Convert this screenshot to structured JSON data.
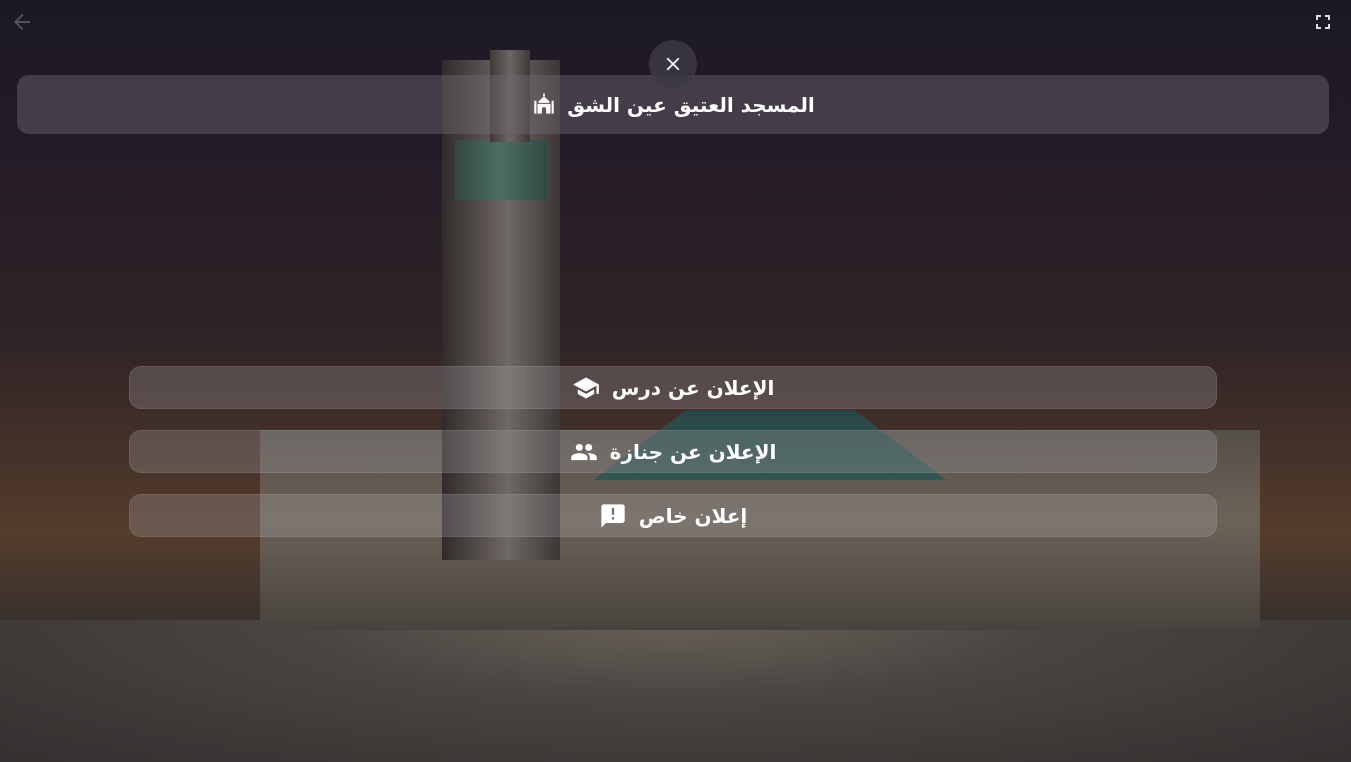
{
  "header": {
    "title": "المسجد العتيق عين الشق",
    "title_icon": "mosque-icon"
  },
  "toolbar": {
    "close_icon": "close-icon",
    "back_icon": "arrow-back-icon",
    "fullscreen_icon": "fullscreen-icon"
  },
  "menu": {
    "items": [
      {
        "label": "الإعلان عن درس",
        "icon": "graduation-cap-icon"
      },
      {
        "label": "الإعلان عن جنازة",
        "icon": "group-icon"
      },
      {
        "label": "إعلان خاص",
        "icon": "announcement-icon"
      }
    ]
  },
  "colors": {
    "text": "#ffffff",
    "panel": "#6e6973",
    "close_button_bg": "#3c3846"
  }
}
